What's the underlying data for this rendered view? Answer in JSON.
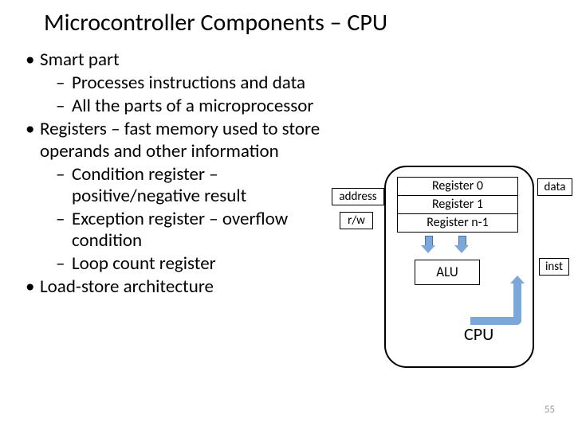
{
  "title": "Microcontroller Components – CPU",
  "bullets": {
    "b1": "Smart part",
    "b1a": "Processes instructions and data",
    "b1b": "All the parts of a microprocessor",
    "b2": "Registers – fast memory used to store operands and other information",
    "b2a": "Condition register – positive/negative result",
    "b2b": "Exception register – overflow condition",
    "b2c": "Loop count register",
    "b3": "Load-store architecture"
  },
  "diagram": {
    "registers": {
      "r0": "Register 0",
      "r1": "Register 1",
      "rn": "Register n-1"
    },
    "alu": "ALU",
    "cpu": "CPU",
    "io": {
      "address": "address",
      "rw": "r/w",
      "data": "data",
      "inst": "inst"
    }
  },
  "page_number": "55"
}
